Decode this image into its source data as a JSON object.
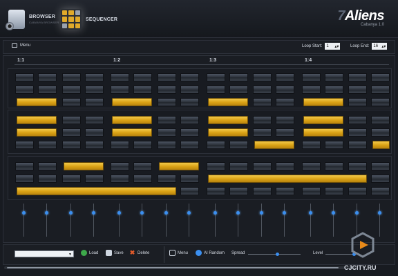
{
  "header": {
    "tabs": [
      {
        "label": "BROWSER",
        "sublabel": "CABANYA BROWSER"
      },
      {
        "label": "SEQUENCER"
      }
    ],
    "logo": {
      "digit": "7",
      "name": "Aliens",
      "version": "Cabanya 1.0"
    }
  },
  "toolbar": {
    "menu_label": "Menu",
    "loop_start_label": "Loop Start:",
    "loop_start_value": "1",
    "loop_end_label": "Loop End:",
    "loop_end_value": "16"
  },
  "ruler": [
    "1:1",
    "1:2",
    "1:3",
    "1:4"
  ],
  "sections": [
    {
      "rows": [
        [
          0,
          0,
          0,
          0,
          0,
          0,
          0,
          0,
          0,
          0,
          0,
          0,
          0,
          0,
          0,
          0
        ],
        [
          0,
          0,
          0,
          0,
          0,
          0,
          0,
          0,
          0,
          0,
          0,
          0,
          0,
          0,
          0,
          0
        ],
        [
          1,
          1,
          0,
          0,
          1,
          1,
          0,
          0,
          1,
          1,
          0,
          0,
          1,
          1,
          0,
          0
        ]
      ]
    },
    {
      "rows": [
        [
          1,
          1,
          0,
          0,
          1,
          1,
          0,
          0,
          1,
          1,
          0,
          0,
          1,
          1,
          0,
          0
        ],
        [
          1,
          1,
          0,
          0,
          1,
          1,
          0,
          0,
          1,
          1,
          0,
          0,
          1,
          1,
          0,
          0
        ],
        [
          0,
          0,
          0,
          0,
          0,
          0,
          0,
          0,
          0,
          0,
          1,
          1,
          0,
          0,
          0,
          1
        ]
      ]
    },
    {
      "rows": [
        [
          0,
          0,
          1,
          1,
          0,
          0,
          1,
          1,
          0,
          0,
          0,
          0,
          0,
          0,
          0,
          0
        ],
        [
          0,
          0,
          0,
          0,
          0,
          0,
          0,
          0,
          1,
          1,
          1,
          1,
          1,
          1,
          1,
          0
        ],
        [
          1,
          1,
          1,
          1,
          1,
          1,
          1,
          0,
          0,
          0,
          0,
          0,
          0,
          0,
          0,
          0
        ]
      ]
    }
  ],
  "mixer": {
    "count": 16,
    "levels": [
      0.25,
      0.25,
      0.25,
      0.25,
      0.25,
      0.25,
      0.25,
      0.25,
      0.25,
      0.25,
      0.25,
      0.25,
      0.25,
      0.25,
      0.25,
      0.25
    ]
  },
  "bottom": {
    "preset_value": "",
    "load_label": "Load",
    "save_label": "Save",
    "delete_label": "Delete",
    "menu_label": "Menu",
    "ai_random_label": "AI Random",
    "spread_label": "Spread",
    "level_label": "Level",
    "spread_value": 0.55,
    "level_value": 0.85
  },
  "watermark": "CJCITY.RU",
  "colors": {
    "accent": "#e0a92a",
    "knob": "#3b8ff0"
  },
  "icons": [
    "browser-icon",
    "sequencer-grid-icon",
    "menu-icon",
    "load-icon",
    "save-icon",
    "delete-icon",
    "ai-random-icon"
  ]
}
